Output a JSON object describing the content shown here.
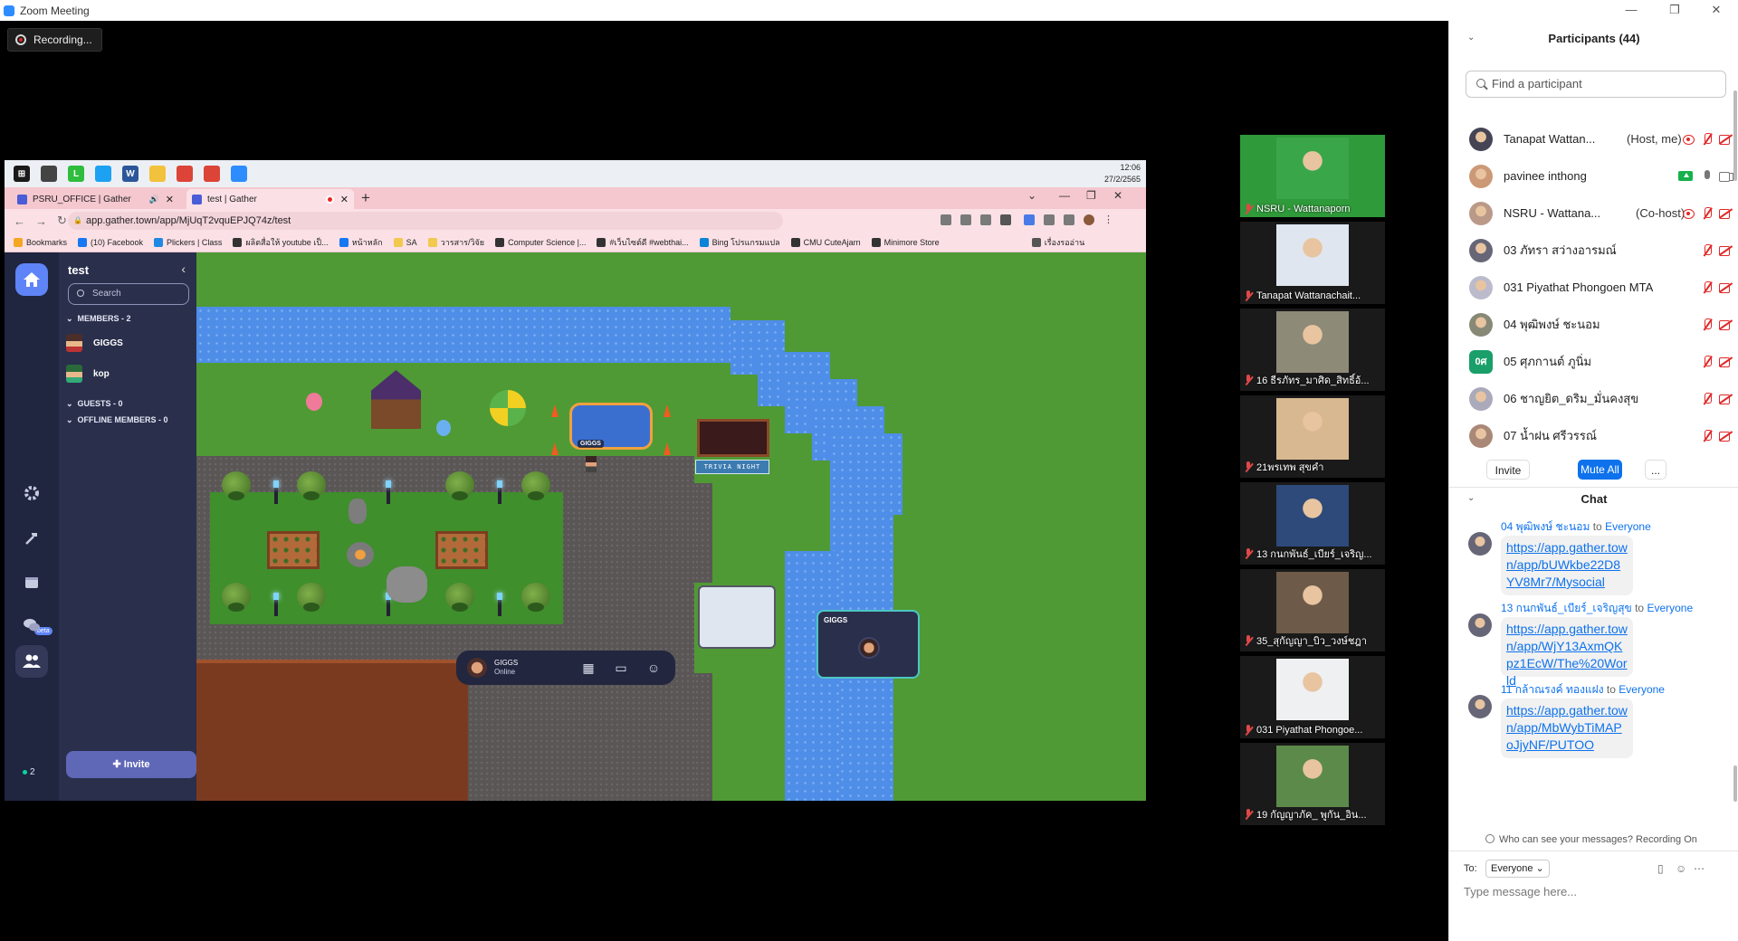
{
  "window": {
    "title": "Zoom Meeting"
  },
  "recording": {
    "label": "Recording..."
  },
  "share": {
    "clock": {
      "time": "12:06",
      "date": "27/2/2565"
    },
    "tabs": [
      {
        "label": "PSRU_OFFICE | Gather"
      },
      {
        "label": "test | Gather"
      }
    ],
    "url": "app.gather.town/app/MjUqT2vquEPJQ74z/test",
    "bookmarks": [
      "Bookmarks",
      "(10) Facebook",
      "Plickers | Class",
      "ผลิตสื่อให้ youtube เป็...",
      "หน้าหลัก",
      "SA",
      "วารสาร/วิจัย",
      "Computer Science |...",
      "#เว็บไซต์ดี #webthai...",
      "Bing โปรแกรมแปล",
      "CMU CuteAjarn",
      "Minimore Store",
      "เรื่องรออ่าน"
    ]
  },
  "gather": {
    "space_name": "test",
    "search_placeholder": "Search",
    "members_header": "MEMBERS - 2",
    "members": [
      {
        "name": "GIGGS"
      },
      {
        "name": "kop"
      }
    ],
    "guests_header": "GUESTS - 0",
    "offline_header": "OFFLINE MEMBERS - 0",
    "invite_label": "Invite",
    "beta_badge": "beta",
    "online_count": "2",
    "trivia_sign": "TRIVIA NIGHT",
    "avatar_nameplate": "GIGGS",
    "bottombar": {
      "name": "GIGGS",
      "status": "Online"
    },
    "selfcam_name": "GIGGS"
  },
  "gallery": [
    {
      "name": "NSRU - Wattanaporn",
      "color": "#3aa64a"
    },
    {
      "name": "Tanapat Wattanachait...",
      "color": "#dfe6ef"
    },
    {
      "name": "16 ธีรภัทร_มาศิด_สิทธิ์อ้...",
      "color": "#8e8a78"
    },
    {
      "name": "21พรเทพ สุขคำ",
      "color": "#d8b890"
    },
    {
      "name": "13 กนกพันธ์_เบียร์_เจริญ...",
      "color": "#2d4a7a"
    },
    {
      "name": "35_สุกัญญา_บิว_วงษ์ชฎา",
      "color": "#6d5a48"
    },
    {
      "name": "031 Piyathat Phongoe...",
      "color": "#eef0f2"
    },
    {
      "name": "19 กัญญาภัค_ พูกัน_อิน...",
      "color": "#5c8a4a"
    }
  ],
  "participants": {
    "title": "Participants (44)",
    "search_placeholder": "Find a participant",
    "list": [
      {
        "name": "Tanapat Wattan...",
        "role": "(Host, me)",
        "color": "#445"
      },
      {
        "name": "pavinee inthong",
        "role": "",
        "color": "#c97"
      },
      {
        "name": "NSRU - Wattana...",
        "role": "(Co-host)",
        "color": "#b98"
      },
      {
        "name": "03 ภัทรา สว่างอารมณ์",
        "role": "",
        "color": "#667"
      },
      {
        "name": "031 Piyathat Phongoen MTA",
        "role": "",
        "color": "#bbc"
      },
      {
        "name": "04 พุฒิพงษ์ ชะนอม",
        "role": "",
        "color": "#887"
      },
      {
        "name": "05 ศุภกานต์ ภูนิ่ม",
        "role": "",
        "initials": "0ศ",
        "color": "#1a9e6a"
      },
      {
        "name": "06 ชาญยิต_ดริม_มั่นคงสุข",
        "role": "",
        "color": "#aab"
      },
      {
        "name": "07 น้ำฝน ศรีวรรณ์",
        "role": "",
        "color": "#a87"
      }
    ],
    "invite_label": "Invite",
    "mute_all_label": "Mute All",
    "more_label": "..."
  },
  "chat": {
    "title": "Chat",
    "to_word": "to",
    "messages": [
      {
        "sender": "04 พุฒิพงษ์ ชะนอม",
        "recipient": "Everyone",
        "text": "https://app.gather.town/app/bUWkbe22D8YV8Mr7/Mysocial"
      },
      {
        "sender": "13 กนกพันธ์_เบียร์_เจริญสุข",
        "recipient": "Everyone",
        "text": "https://app.gather.town/app/WjY13AxmQKpz1EcW/The%20World"
      },
      {
        "sender": "11 กล้าณรงค์ ทองแฝง",
        "recipient": "Everyone",
        "text": "https://app.gather.town/app/MbWybTiMAPoJjyNF/PUTOO"
      }
    ],
    "privacy_note": "Who can see your messages? Recording On",
    "to_label": "To:",
    "to_value": "Everyone",
    "input_placeholder": "Type message here..."
  }
}
